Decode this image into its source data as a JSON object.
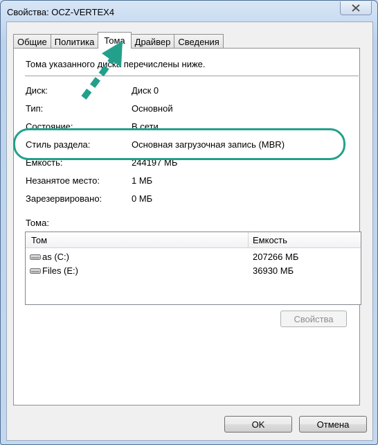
{
  "window": {
    "title": "Свойства: OCZ-VERTEX4"
  },
  "tabs": [
    {
      "label": "Общие"
    },
    {
      "label": "Политика"
    },
    {
      "label": "Тома"
    },
    {
      "label": "Драйвер"
    },
    {
      "label": "Сведения"
    }
  ],
  "intro": "Тома указанного диска перечислены ниже.",
  "properties": [
    {
      "label": "Диск:",
      "value": "Диск 0"
    },
    {
      "label": "Тип:",
      "value": "Основной"
    },
    {
      "label": "Состояние:",
      "value": "В сети"
    },
    {
      "label": "Стиль раздела:",
      "value": "Основная загрузочная запись (MBR)"
    },
    {
      "label": "Емкость:",
      "value": "244197 МБ"
    },
    {
      "label": "Незанятое место:",
      "value": "1 МБ"
    },
    {
      "label": "Зарезервировано:",
      "value": "0 МБ"
    }
  ],
  "volumes": {
    "label": "Тома:",
    "columns": [
      "Том",
      "Емкость"
    ],
    "rows": [
      {
        "name": "as (C:)",
        "capacity": "207266 МБ"
      },
      {
        "name": "Files (E:)",
        "capacity": "36930 МБ"
      }
    ]
  },
  "buttons": {
    "properties": "Свойства",
    "ok": "OK",
    "cancel": "Отмена"
  },
  "colors": {
    "highlight": "#23a08c"
  }
}
